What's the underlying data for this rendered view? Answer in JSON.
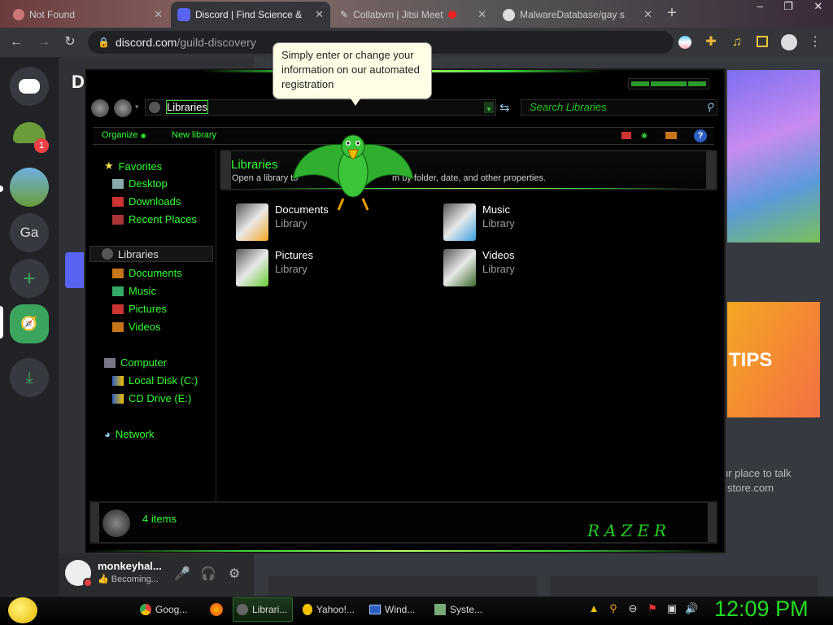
{
  "browser": {
    "tabs": [
      {
        "title": "Not Found"
      },
      {
        "title": "Discord | Find Science &"
      },
      {
        "title": "Collabvm | Jitsi Meet"
      },
      {
        "title": "MalwareDatabase/gay s"
      }
    ],
    "url_host": "discord.com",
    "url_path": "/guild-discovery"
  },
  "discord": {
    "badge_count": "1",
    "server_ga": "Ga",
    "user_name": "monkeyhal...",
    "user_status": "Becoming...",
    "right_text_line1": "ur place to talk",
    "right_text_line2": "store.com",
    "promo_text": "TIPS",
    "left_cut_letter": "D"
  },
  "tooltip": {
    "text": "Simply enter or change your information on our automated registration"
  },
  "explorer": {
    "address": "Libraries",
    "search_placeholder": "Search Libraries",
    "toolbar": {
      "organize": "Organize",
      "new_library": "New library"
    },
    "nav": {
      "favorites": "Favorites",
      "favorites_items": [
        "Desktop",
        "Downloads",
        "Recent Places"
      ],
      "libraries": "Libraries",
      "libraries_items": [
        "Documents",
        "Music",
        "Pictures",
        "Videos"
      ],
      "computer": "Computer",
      "computer_items": [
        "Local Disk (C:)",
        "CD Drive (E:)"
      ],
      "network": "Network"
    },
    "header": {
      "title": "Libraries",
      "subtitle_left": "Open a library to",
      "subtitle_right": "m by folder, date, and other properties."
    },
    "libraries": [
      {
        "name": "Documents",
        "type": "Library"
      },
      {
        "name": "Music",
        "type": "Library"
      },
      {
        "name": "Pictures",
        "type": "Library"
      },
      {
        "name": "Videos",
        "type": "Library"
      }
    ],
    "status": "4 items",
    "brand": "RAZER"
  },
  "taskbar": {
    "tasks": [
      "Goog...",
      "Librari...",
      "Yahoo!...",
      "Wind...",
      "Syste..."
    ],
    "clock": "12:09 PM"
  },
  "colors": {
    "accent_green": "#33ff33",
    "discord_bg": "#36393f",
    "chrome_bg": "#35363a"
  }
}
